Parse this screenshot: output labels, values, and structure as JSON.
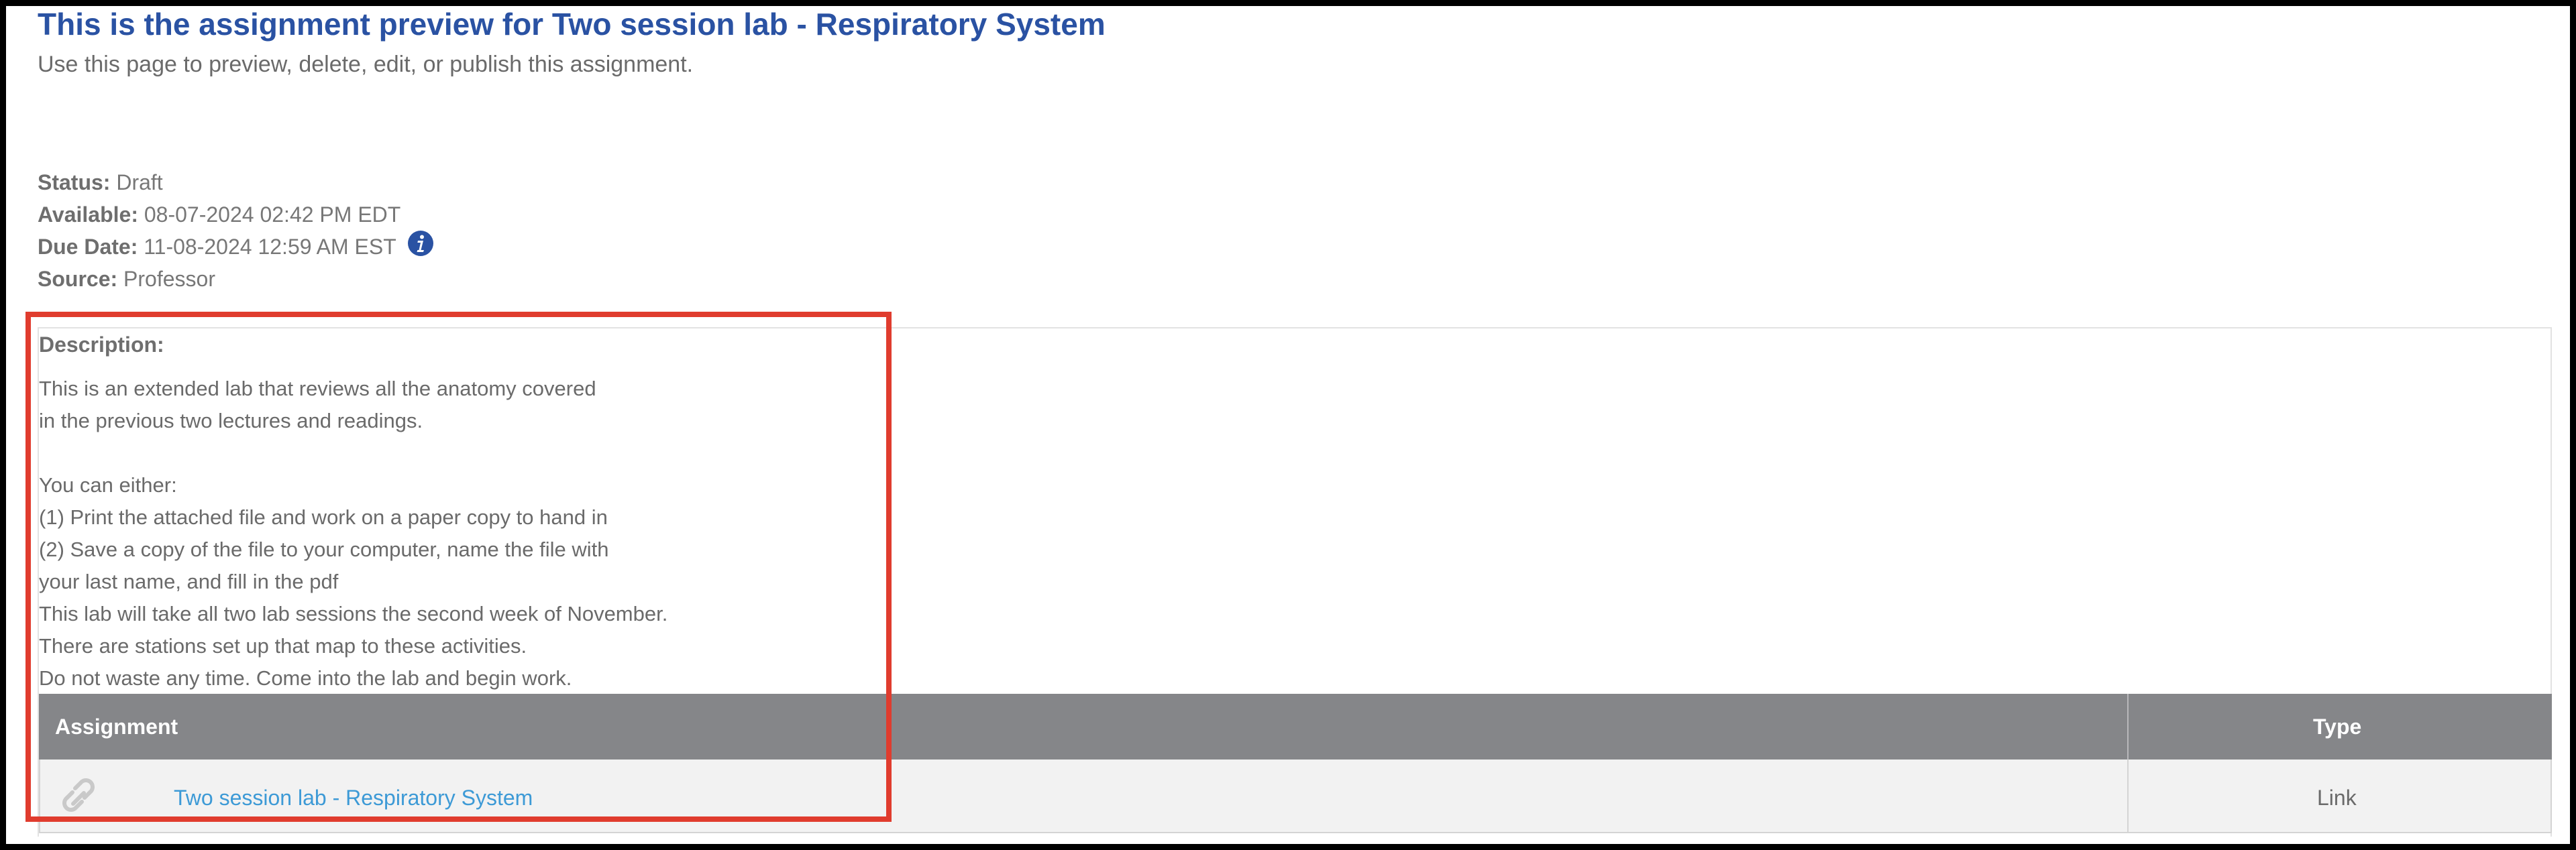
{
  "header": {
    "title": "This is the assignment preview for Two session lab - Respiratory System",
    "subtitle": "Use this page to preview, delete, edit, or publish this assignment."
  },
  "meta": {
    "status_label": "Status:",
    "status_value": "Draft",
    "available_label": "Available:",
    "available_value": "08-07-2024 02:42 PM EDT",
    "due_label": "Due Date:",
    "due_value": "11-08-2024 12:59 AM EST",
    "due_info_icon": "info-icon",
    "source_label": "Source:",
    "source_value": "Professor"
  },
  "description": {
    "label": "Description:",
    "text": "This is an extended lab that reviews all the anatomy covered\nin the previous two lectures and readings.\n\nYou can either:\n(1) Print the attached file and work on a paper copy to hand in\n(2) Save a copy of the file to your computer, name the file with\nyour last name, and fill in the pdf\nThis lab will take all two lab sessions the second week of November.\nThere are stations set up that map to these activities.\nDo not waste any time. Come into the lab and begin work."
  },
  "table": {
    "columns": [
      "Assignment",
      "Type"
    ],
    "rows": [
      {
        "icon": "link-icon",
        "name": "Two session lab - Respiratory System",
        "type": "Link"
      }
    ]
  },
  "colors": {
    "title": "#2a52a3",
    "table_header": "#858689",
    "link": "#3d9ad6",
    "highlight": "#e03c2e"
  }
}
